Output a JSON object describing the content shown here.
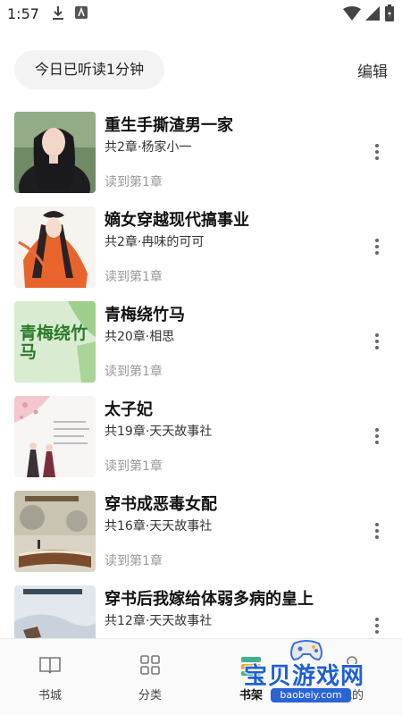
{
  "status_bar": {
    "time": "1:57"
  },
  "header": {
    "reading_time": "今日已听读1分钟",
    "edit_label": "编辑"
  },
  "books": [
    {
      "title": "重生手撕渣男一家",
      "meta": "共2章·杨家小一",
      "progress": "读到第1章"
    },
    {
      "title": "嫡女穿越现代搞事业",
      "meta": "共2章·冉味的可可",
      "progress": "读到第1章"
    },
    {
      "title": "青梅绕竹马",
      "meta": "共20章·相思",
      "progress": "读到第1章",
      "cover_text": "青梅绕竹马"
    },
    {
      "title": "太子妃",
      "meta": "共19章·天天故事社",
      "progress": "读到第1章"
    },
    {
      "title": "穿书成恶毒女配",
      "meta": "共16章·天天故事社",
      "progress": "读到第1章"
    },
    {
      "title": "穿书后我嫁给体弱多病的皇上",
      "meta": "共12章·天天故事社",
      "progress": ""
    }
  ],
  "nav": {
    "items": [
      {
        "label": "书城"
      },
      {
        "label": "分类"
      },
      {
        "label": "书架"
      },
      {
        "label": "我的"
      }
    ],
    "active": "书架"
  },
  "watermark": {
    "title": "宝贝游戏网",
    "url": "baobeiy.com"
  }
}
